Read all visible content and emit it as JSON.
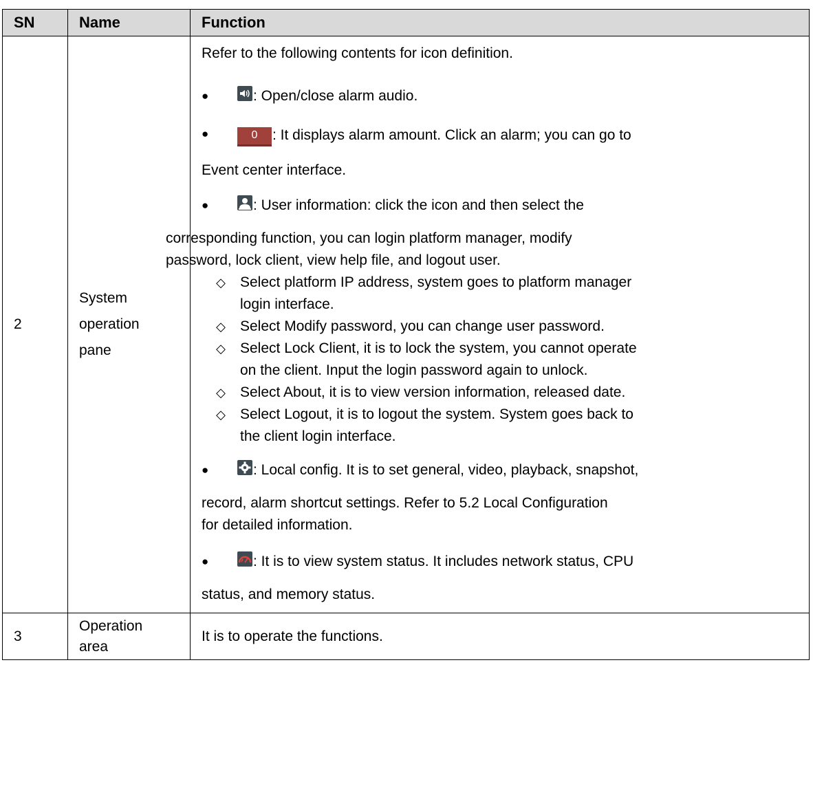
{
  "header": {
    "sn": "SN",
    "name": "Name",
    "function": "Function"
  },
  "row2": {
    "sn": "2",
    "name_lines": [
      "System",
      "operation",
      "pane"
    ],
    "intro": "Refer to the following contents for icon definition.",
    "alarm_audio": ": Open/close alarm audio.",
    "alarm_count_value": "0",
    "alarm_count_line1": ": It displays alarm amount. Click an alarm; you can go to",
    "alarm_count_line2": "Event center interface.",
    "user_line1": ": User information: click the icon and then select the",
    "user_line2": "corresponding function, you can login platform manager, modify",
    "user_line3": "password, lock client, view help file, and logout user.",
    "sub_items": [
      {
        "line1": "Select platform IP address, system goes to platform manager",
        "line2": "login interface."
      },
      {
        "line1": "Select Modify password, you can change user password.",
        "line2": ""
      },
      {
        "line1": "Select Lock Client, it is to lock the system, you cannot operate",
        "line2": "on the client. Input the login password again to unlock."
      },
      {
        "line1": "Select About, it is to view version information, released date.",
        "line2": ""
      },
      {
        "line1": "Select Logout, it is to logout the system. System goes back to",
        "line2": "the client login interface."
      }
    ],
    "diamond_symbol": "◇",
    "bullet_symbol": "●",
    "local_line1": ": Local config. It is to set general, video, playback, snapshot,",
    "local_line2": "record, alarm shortcut settings. Refer to 5.2 Local Configuration",
    "local_line3": "for detailed information.",
    "status_line1": ": It is to view system status. It includes network status, CPU",
    "status_line2": "status, and memory status."
  },
  "row3": {
    "sn": "3",
    "name_lines": [
      "Operation",
      "area"
    ],
    "function": "It is to operate the functions."
  },
  "icons": {
    "audio": "speaker-icon",
    "alarm": "alarm-count-icon",
    "user": "user-icon",
    "config": "gear-icon",
    "status": "speedometer-icon"
  },
  "colors": {
    "header_bg": "#d9d9d9",
    "alarm_bg": "#a0413b",
    "icon_dark": "#3f4b52",
    "status_red": "#e0403a"
  }
}
